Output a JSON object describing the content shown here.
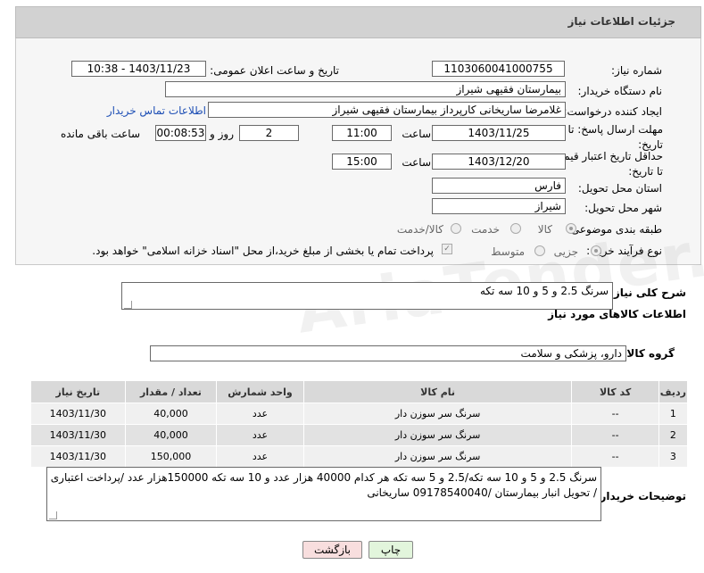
{
  "header": {
    "title": "جزئیات اطلاعات نیاز"
  },
  "fields": {
    "need_number_label": "شماره نیاز:",
    "need_number": "1103060041000755",
    "announce_label": "تاریخ و ساعت اعلان عمومی:",
    "announce_value": "1403/11/23 - 10:38",
    "buyer_org_label": "نام دستگاه خریدار:",
    "buyer_org": "بیمارستان فقیهی شیراز",
    "creator_label": "ایجاد کننده درخواست:",
    "creator": "غلامرضا ساریخانی کارپرداز بیمارستان فقیهی شیراز",
    "contact_link": "اطلاعات تماس خریدار",
    "deadline_label": "مهلت ارسال پاسخ: تا تاریخ:",
    "deadline_date": "1403/11/25",
    "time_label": "ساعت",
    "deadline_time": "11:00",
    "days_value": "2",
    "days_label": "روز و",
    "remaining_value": "00:08:53",
    "remaining_label": "ساعت باقی مانده",
    "validity_label": "حداقل تاریخ اعتبار قیمت: تا تاریخ:",
    "validity_date": "1403/12/20",
    "validity_time": "15:00",
    "province_label": "استان محل تحویل:",
    "province": "فارس",
    "city_label": "شهر محل تحویل:",
    "city": "شیراز",
    "category_label": "طبقه بندی موضوعی:",
    "category_options": [
      "کالا",
      "خدمت",
      "کالا/خدمت"
    ],
    "process_label": "نوع فرآیند خرید :",
    "process_options": [
      "جزیی",
      "متوسط"
    ],
    "payment_note": "پرداخت تمام یا بخشی از مبلغ خرید،از محل \"اسناد خزانه اسلامی\" خواهد بود."
  },
  "summary": {
    "label": "شرح کلی نیاز:",
    "value": "سرنگ 2.5 و 5 و 10 سه تکه"
  },
  "goods_info_title": "اطلاعات کالاهای مورد نیاز",
  "goods_group": {
    "label": "گروه کالا:",
    "value": "دارو، پزشکی و سلامت"
  },
  "table": {
    "headers": [
      "ردیف",
      "کد کالا",
      "نام کالا",
      "واحد شمارش",
      "تعداد / مقدار",
      "تاریخ نیاز"
    ],
    "rows": [
      [
        "1",
        "--",
        "سرنگ سر سوزن دار",
        "عدد",
        "40,000",
        "1403/11/30"
      ],
      [
        "2",
        "--",
        "سرنگ سر سوزن دار",
        "عدد",
        "40,000",
        "1403/11/30"
      ],
      [
        "3",
        "--",
        "سرنگ سر سوزن دار",
        "عدد",
        "150,000",
        "1403/11/30"
      ]
    ]
  },
  "buyer_notes": {
    "label": "توضیحات خریدار:",
    "value": "سرنگ 2.5 و 5 و 10 سه تکه/2.5 و 5 سه تکه هر کدام 40000 هزار عدد و 10 سه تکه 150000هزار عدد /پرداخت اعتباری / تحویل انبار بیمارستان /09178540040 ساریخانی"
  },
  "buttons": {
    "print": "چاپ",
    "back": "بازگشت"
  },
  "watermark": "AriaTender.neT",
  "colors": {
    "link": "#1e4fb5",
    "header_bg": "#d2d2d2",
    "back_button_bg": "#f8dede",
    "print_button_bg": "#e2f5dc"
  }
}
